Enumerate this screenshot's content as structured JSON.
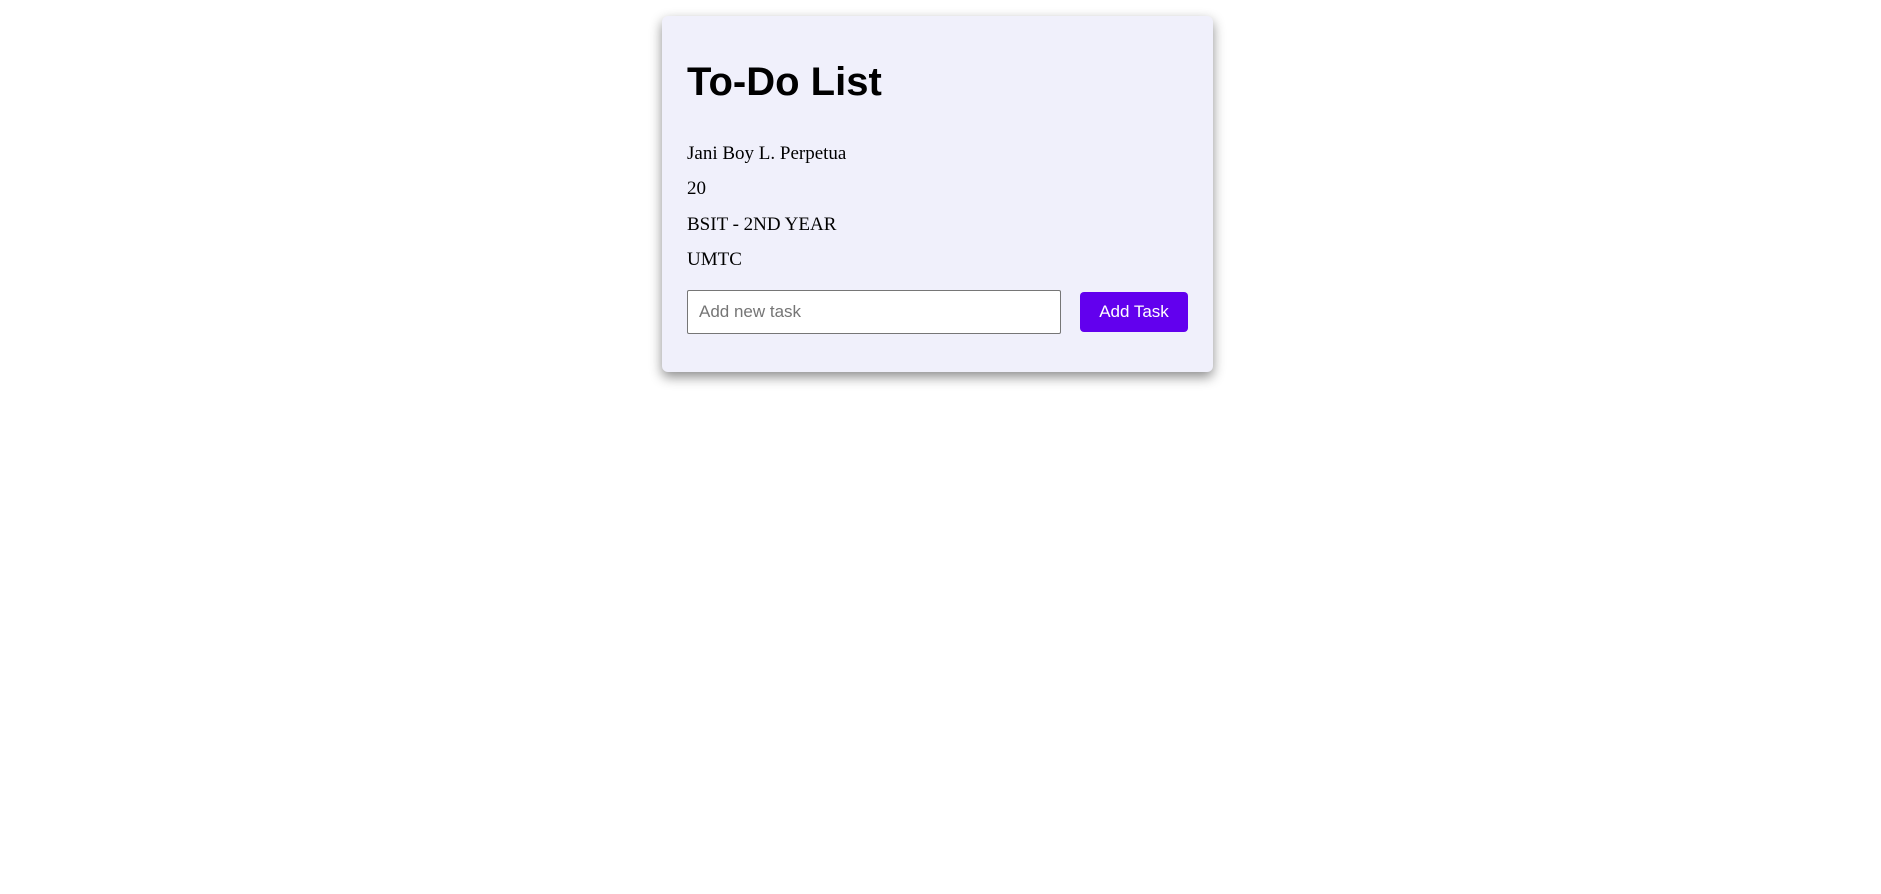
{
  "todo": {
    "title": "To-Do List",
    "info": {
      "name": "Jani Boy L. Perpetua",
      "age": "20",
      "course": "BSIT - 2ND YEAR",
      "school": "UMTC"
    },
    "input": {
      "placeholder": "Add new task",
      "value": ""
    },
    "add_button_label": "Add Task"
  },
  "colors": {
    "card_background": "#f0f0fb",
    "button_accent": "#6200ee",
    "page_background": "#ffffff"
  }
}
